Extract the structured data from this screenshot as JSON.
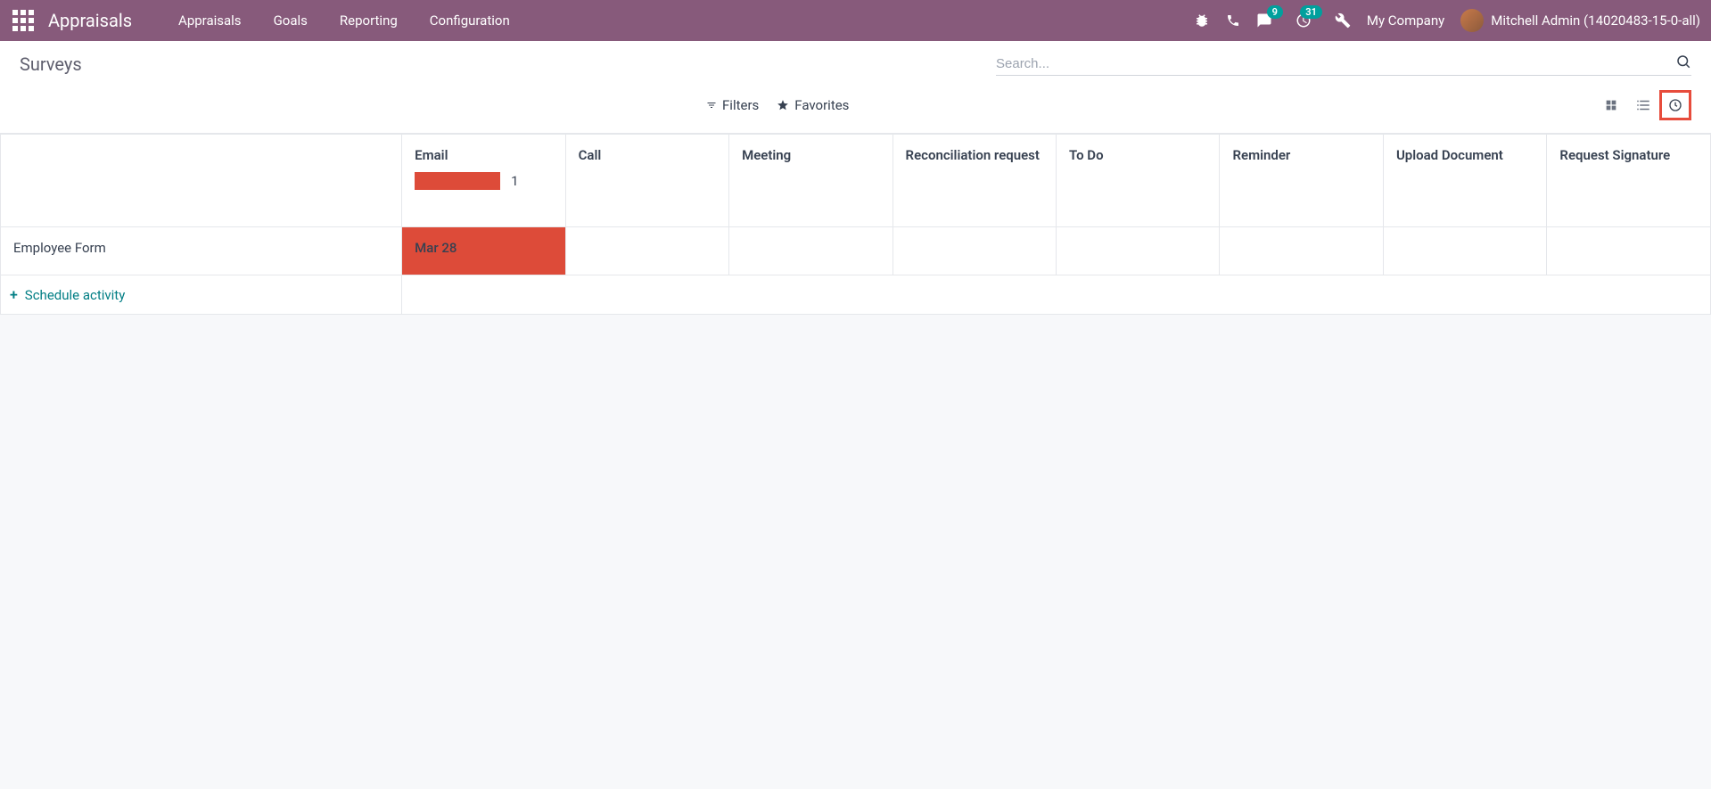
{
  "navbar": {
    "brand": "Appraisals",
    "menu": [
      "Appraisals",
      "Goals",
      "Reporting",
      "Configuration"
    ],
    "messages_badge": "9",
    "activities_badge": "31",
    "company": "My Company",
    "user": "Mitchell Admin (14020483-15-0-all)"
  },
  "page": {
    "title": "Surveys",
    "search_placeholder": "Search...",
    "filters_label": "Filters",
    "favorites_label": "Favorites"
  },
  "table": {
    "columns": [
      "Email",
      "Call",
      "Meeting",
      "Reconciliation request",
      "To Do",
      "Reminder",
      "Upload Document",
      "Request Signature"
    ],
    "email_progress_count": "1",
    "rows": [
      {
        "name": "Employee Form",
        "cells": [
          "Mar 28",
          "",
          "",
          "",
          "",
          "",
          "",
          ""
        ]
      }
    ],
    "schedule_label": "Schedule activity"
  },
  "colors": {
    "navbar_bg": "#875a7b",
    "accent_teal": "#00a09d",
    "danger_red": "#dd4b39",
    "link_teal": "#017e84"
  }
}
